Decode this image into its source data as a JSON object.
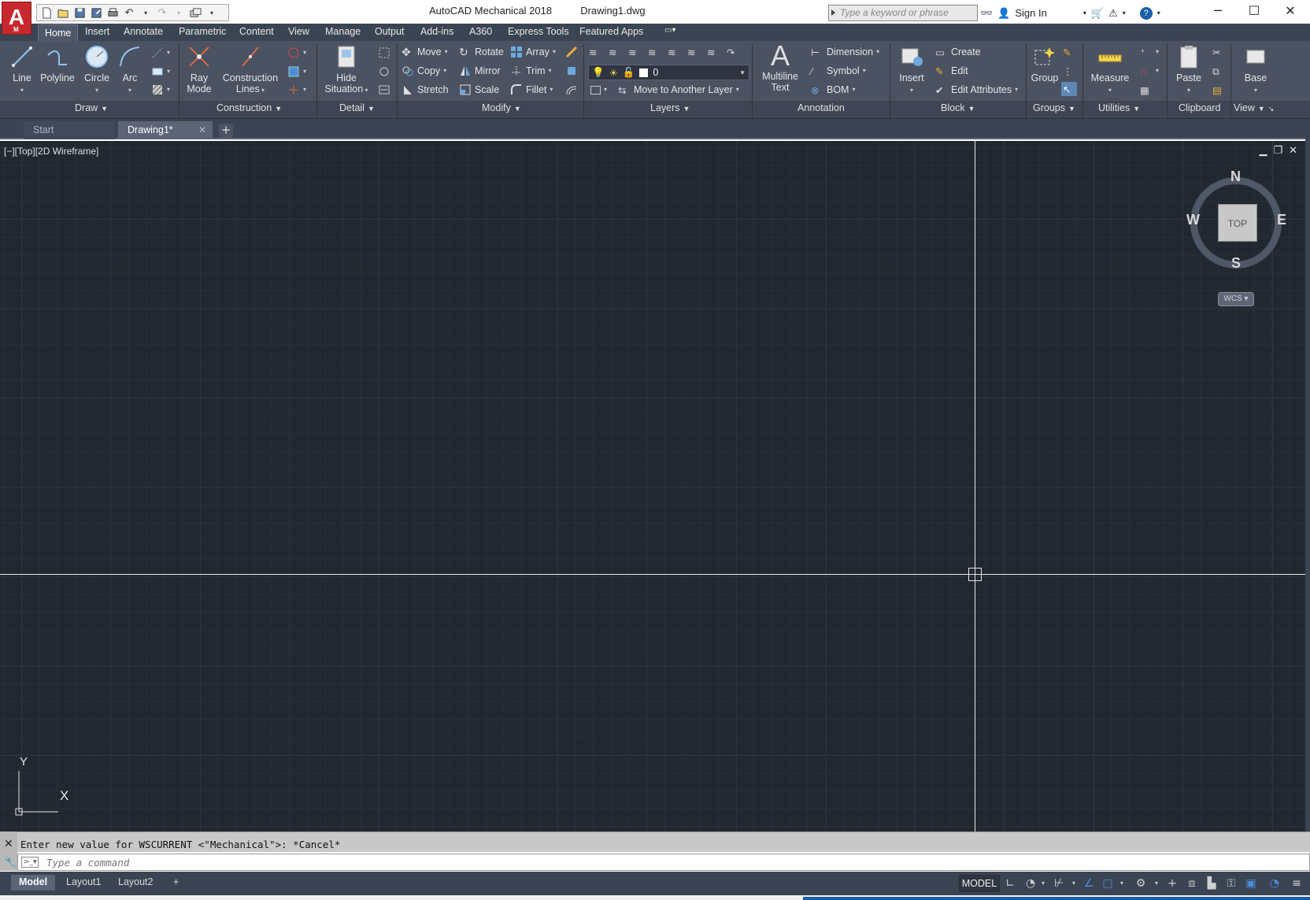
{
  "app": {
    "title": "AutoCAD Mechanical 2018",
    "document": "Drawing1.dwg",
    "logo_letter": "A",
    "logo_sub": "M"
  },
  "titlebar": {
    "search_placeholder": "Type a keyword or phrase",
    "sign_in": "Sign In",
    "help": "?"
  },
  "ribbon_tabs": [
    "Home",
    "Insert",
    "Annotate",
    "Parametric",
    "Content",
    "View",
    "Manage",
    "Output",
    "Add-ins",
    "A360",
    "Express Tools",
    "Featured Apps"
  ],
  "ribbon": {
    "draw": {
      "line": "Line",
      "polyline": "Polyline",
      "circle": "Circle",
      "arc": "Arc",
      "panel": "Draw"
    },
    "construction": {
      "ray_mode_1": "Ray",
      "ray_mode_2": "Mode",
      "construction_lines_1": "Construction",
      "construction_lines_2": "Lines",
      "panel": "Construction"
    },
    "detail": {
      "hide_situation_1": "Hide",
      "hide_situation_2": "Situation",
      "panel": "Detail"
    },
    "modify": {
      "move": "Move",
      "rotate": "Rotate",
      "array": "Array",
      "copy": "Copy",
      "mirror": "Mirror",
      "trim": "Trim",
      "stretch": "Stretch",
      "scale": "Scale",
      "fillet": "Fillet",
      "panel": "Modify"
    },
    "layers": {
      "current_layer": "0",
      "move_to_another_layer": "Move to Another Layer",
      "panel": "Layers"
    },
    "annotation": {
      "multiline_text_1": "Multiline",
      "multiline_text_2": "Text",
      "dimension": "Dimension",
      "symbol": "Symbol",
      "bom": "BOM",
      "panel": "Annotation"
    },
    "block": {
      "insert": "Insert",
      "create": "Create",
      "edit": "Edit",
      "edit_attributes": "Edit Attributes",
      "panel": "Block"
    },
    "groups": {
      "group": "Group",
      "panel": "Groups"
    },
    "utilities": {
      "measure": "Measure",
      "panel": "Utilities"
    },
    "clipboard": {
      "paste": "Paste",
      "panel": "Clipboard"
    },
    "view": {
      "base": "Base",
      "panel": "View"
    }
  },
  "file_tabs": {
    "start": "Start",
    "drawing": "Drawing1*",
    "add": "+"
  },
  "viewport": {
    "label": "[−][Top][2D Wireframe]",
    "viewcube": {
      "face": "TOP",
      "n": "N",
      "s": "S",
      "e": "E",
      "w": "W",
      "wcs": "WCS"
    },
    "ucs": {
      "x": "X",
      "y": "Y"
    }
  },
  "command": {
    "history": "Enter new value for WSCURRENT <\"Mechanical\">: *Cancel*",
    "placeholder": "Type a command"
  },
  "layout_tabs": [
    "Model",
    "Layout1",
    "Layout2"
  ],
  "status": {
    "model": "MODEL"
  },
  "colors": {
    "canvas_bg": "#212830",
    "ribbon_bg": "#4b5262",
    "tabbar_bg": "#3b4453",
    "logo_red": "#c8282d"
  }
}
